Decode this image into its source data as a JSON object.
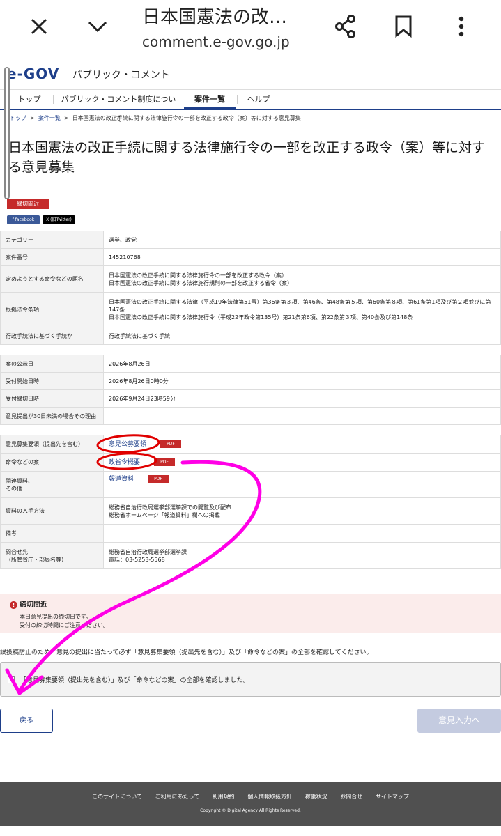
{
  "browser": {
    "title": "日本国憲法の改…",
    "url": "comment.e-gov.go.jp"
  },
  "site": {
    "logo": "e-GOV",
    "logo_sub": "パブリック・コメント"
  },
  "nav": {
    "top": "トップ",
    "about": "パブリック・コメント制度について",
    "list": "案件一覧",
    "help": "ヘルプ"
  },
  "breadcrumb": {
    "top": "トップ",
    "sep1": ">",
    "list": "案件一覧",
    "sep2": ">",
    "current": "日本国憲法の改正手続に関する法律施行令の一部を改正する政令（案）等に対する意見募集"
  },
  "page_title": "日本国憲法の改正手続に関する法律施行令の一部を改正する政令（案）等に対する意見募集",
  "status_badge": "締切間近",
  "share": {
    "facebook": "f facebook",
    "x": "X (旧Twitter)"
  },
  "table1": {
    "rows": [
      {
        "label": "カテゴリー",
        "value": "選挙、政党"
      },
      {
        "label": "案件番号",
        "value": "145210768"
      },
      {
        "label": "定めようとする命令などの題名",
        "value": "日本国憲法の改正手続に関する法律施行令の一部を改正する政令（案）",
        "value2": "日本国憲法の改正手続に関する法律施行規則の一部を改正する省令（案）"
      },
      {
        "label": "根拠法令条項",
        "value": "日本国憲法の改正手続に関する法律（平成19年法律第51号）第36条第３項、第46条、第48条第５項、第60条第８項、第61条第1項及び第２項並びに第147条",
        "value2": "日本国憲法の改正手続に関する法律施行令（平成22年政令第135号）第21条第6項、第22条第３項、第40条及び第148条"
      },
      {
        "label": "行政手続法に基づく手続か",
        "value": "行政手続法に基づく手続"
      }
    ]
  },
  "table2": {
    "rows": [
      {
        "label": "案の公示日",
        "value": "2026年8月26日"
      },
      {
        "label": "受付開始日時",
        "value": "2026年8月26日0時0分"
      },
      {
        "label": "受付締切日時",
        "value": "2026年9月24日23時59分"
      },
      {
        "label": "意見提出が30日未満の場合その理由",
        "value": ""
      }
    ]
  },
  "table3": {
    "r1_label": "意見募集要領（提出先を含む）",
    "r1_link": "意見公募要領",
    "r2_label": "命令などの案",
    "r2_link": "政省令概要",
    "r3_label": "関連資料、",
    "r3_label2": "その他",
    "r3_link": "報道資料",
    "pdf": "PDF",
    "r4_label": "資料の入手方法",
    "r4_value": "総務省自治行政局選挙部選挙課での閲覧及び配布",
    "r4_value2": "総務省ホームページ「報道資料」欄への掲載",
    "r5_label": "備考",
    "r6_label": "問合せ先",
    "r6_label2": "（所管省庁・部局名等）",
    "r6_value": "総務省自治行政局選挙部選挙課",
    "r6_value2": "電話：03-5253-5568"
  },
  "alert": {
    "icon": "!",
    "title": "締切間近",
    "line1": "本日意見提出の締切日です。",
    "line2": "受付の締切時間にご注意ください。"
  },
  "note": "誤投稿防止のため、意見の提出に当たって必ず「意見募集要領（提出先を含む）」及び「命令などの案」の全部を確認してください。",
  "checkbox_label": "「意見募集要領（提出先を含む）」及び「命令などの案」の全部を確認しました。",
  "buttons": {
    "back": "戻る",
    "next": "意見入力へ"
  },
  "footer": {
    "links": [
      "このサイトについて",
      "ご利用にあたって",
      "利用規約",
      "個人情報取扱方針",
      "稼働状況",
      "お問合せ",
      "サイトマップ"
    ],
    "copyright": "Copyright © Digital Agency All Rights Reserved."
  },
  "colors": {
    "brand": "#1e3f8a",
    "alert": "#c52a2a",
    "annotation": "#ff00e6",
    "circle": "#e00000"
  }
}
